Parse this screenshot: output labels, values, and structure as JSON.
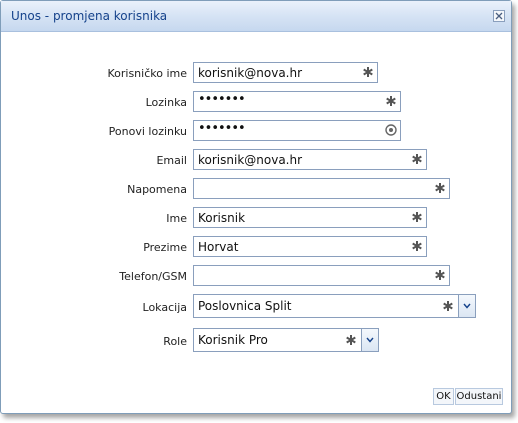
{
  "window": {
    "title": "Unos - promjena korisnika"
  },
  "form": {
    "username_label": "Korisničko ime",
    "username_value": "korisnik@nova.hr",
    "password_label": "Lozinka",
    "password_value": "•••••••",
    "repeat_password_label": "Ponovi lozinku",
    "repeat_password_value": "•••••••",
    "email_label": "Email",
    "email_value": "korisnik@nova.hr",
    "note_label": "Napomena",
    "note_value": "",
    "first_name_label": "Ime",
    "first_name_value": "Korisnik",
    "last_name_label": "Prezime",
    "last_name_value": "Horvat",
    "phone_label": "Telefon/GSM",
    "phone_value": "",
    "location_label": "Lokacija",
    "location_value": "Poslovnica Split",
    "role_label": "Role",
    "role_value": "Korisnik Pro"
  },
  "footer": {
    "ok_label": "OK",
    "cancel_label": "Odustani"
  },
  "colors": {
    "title_text": "#15428b",
    "border": "#8a9fbd",
    "required_icon": "#555555"
  },
  "icons": {
    "required": "asterisk-icon",
    "password_ok": "check-circle-icon",
    "dropdown": "chevron-down-icon",
    "close": "close-icon"
  }
}
